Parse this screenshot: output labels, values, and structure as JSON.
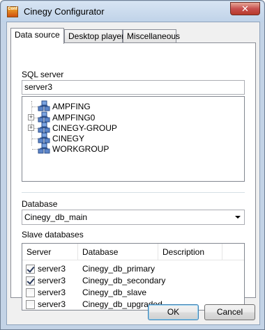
{
  "window": {
    "title": "Cinegy Configurator",
    "app_icon_text": "Conf",
    "close_glyph": "✕"
  },
  "tabs": [
    {
      "label": "Data source",
      "active": true
    },
    {
      "label": "Desktop player",
      "active": false
    },
    {
      "label": "Miscellaneous",
      "active": false
    }
  ],
  "sql_server": {
    "label": "SQL server",
    "value": "server3",
    "tree": [
      {
        "label": "AMPFING",
        "expandable": false
      },
      {
        "label": "AMPFING0",
        "expandable": true
      },
      {
        "label": "CINEGY-GROUP",
        "expandable": true
      },
      {
        "label": "CINEGY",
        "expandable": false
      },
      {
        "label": "WORKGROUP",
        "expandable": false
      }
    ]
  },
  "database": {
    "label": "Database",
    "selected": "Cinegy_db_main"
  },
  "slave_databases": {
    "label": "Slave databases",
    "columns": [
      "Server",
      "Database",
      "Description"
    ],
    "rows": [
      {
        "checked": true,
        "server": "server3",
        "database": "Cinegy_db_primary",
        "description": ""
      },
      {
        "checked": true,
        "server": "server3",
        "database": "Cinegy_db_secondary",
        "description": ""
      },
      {
        "checked": false,
        "server": "server3",
        "database": "Cinegy_db_slave",
        "description": ""
      },
      {
        "checked": false,
        "server": "server3",
        "database": "Cinegy_db_upgraded",
        "description": ""
      }
    ]
  },
  "buttons": {
    "ok": "OK",
    "cancel": "Cancel"
  }
}
